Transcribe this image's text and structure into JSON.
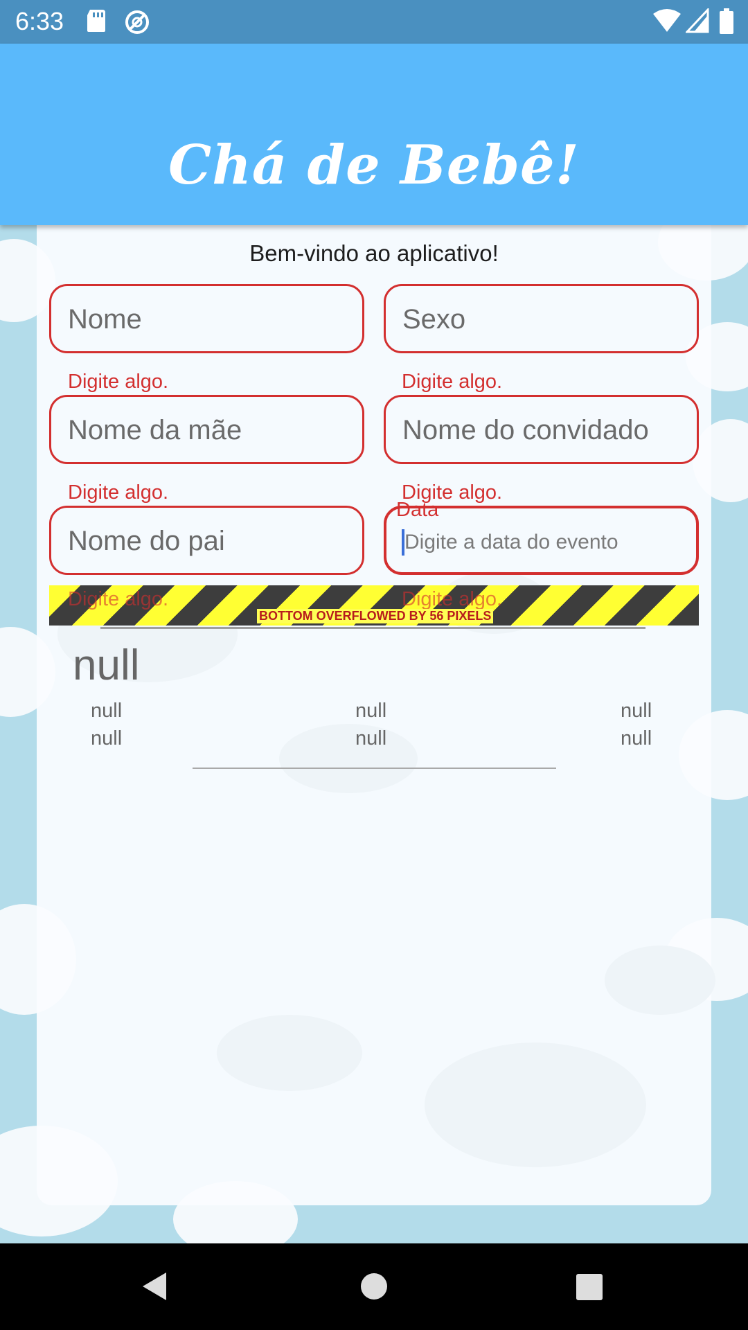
{
  "status_bar": {
    "time": "6:33",
    "icons": [
      "sd-card-icon",
      "sync-icon",
      "wifi-icon",
      "signal-icon",
      "battery-icon"
    ]
  },
  "app_bar": {
    "title": "Chá de Bebê!",
    "color": "#5ab9fb"
  },
  "form": {
    "welcome": "Bem-vindo ao aplicativo!",
    "fields": {
      "nome": {
        "placeholder": "Nome",
        "error": "Digite algo."
      },
      "sexo": {
        "placeholder": "Sexo",
        "error": "Digite algo."
      },
      "mae": {
        "placeholder": "Nome da mãe",
        "error": "Digite algo."
      },
      "convidado": {
        "placeholder": "Nome do convidado",
        "error": "Digite algo."
      },
      "pai": {
        "placeholder": "Nome do pai",
        "error": "Digite algo."
      },
      "data": {
        "label": "Data",
        "placeholder": "Digite a data do evento",
        "error": "Digite algo."
      }
    },
    "error_color": "#d32f2f"
  },
  "overflow_warning": "BOTTOM OVERFLOWED BY 56 PIXELS",
  "summary": {
    "title": "null",
    "row1": [
      "null",
      "null",
      "null"
    ],
    "row2": [
      "null",
      "null",
      "null"
    ]
  }
}
